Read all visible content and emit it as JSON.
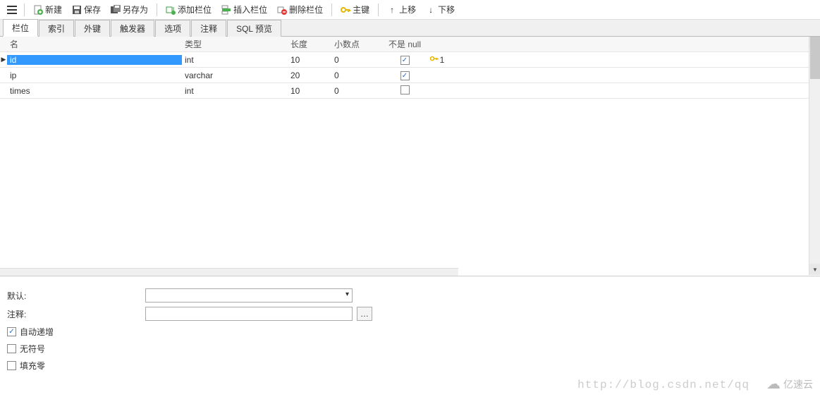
{
  "toolbar": {
    "new": "新建",
    "save": "保存",
    "save_as": "另存为",
    "add_col": "添加栏位",
    "insert_col": "插入栏位",
    "delete_col": "删除栏位",
    "primary_key": "主键",
    "move_up": "上移",
    "move_down": "下移"
  },
  "tabs": {
    "fields": "栏位",
    "indexes": "索引",
    "foreign_keys": "外键",
    "triggers": "触发器",
    "options": "选项",
    "comment": "注释",
    "sql_preview": "SQL 预览"
  },
  "grid": {
    "headers": {
      "name": "名",
      "type": "类型",
      "length": "长度",
      "decimals": "小数点",
      "not_null": "不是 null"
    },
    "rows": [
      {
        "name": "id",
        "type": "int",
        "length": "10",
        "decimals": "0",
        "not_null": true,
        "pk": "1",
        "selected": true
      },
      {
        "name": "ip",
        "type": "varchar",
        "length": "20",
        "decimals": "0",
        "not_null": true,
        "pk": "",
        "selected": false
      },
      {
        "name": "times",
        "type": "int",
        "length": "10",
        "decimals": "0",
        "not_null": false,
        "pk": "",
        "selected": false
      }
    ]
  },
  "form": {
    "default_label": "默认:",
    "default_value": "",
    "comment_label": "注释:",
    "comment_value": "",
    "auto_increment": "自动递增",
    "auto_increment_on": true,
    "unsigned": "无符号",
    "unsigned_on": false,
    "zerofill": "填充零",
    "zerofill_on": false
  },
  "watermark": "http://blog.csdn.net/qq",
  "logo_text": "亿速云"
}
